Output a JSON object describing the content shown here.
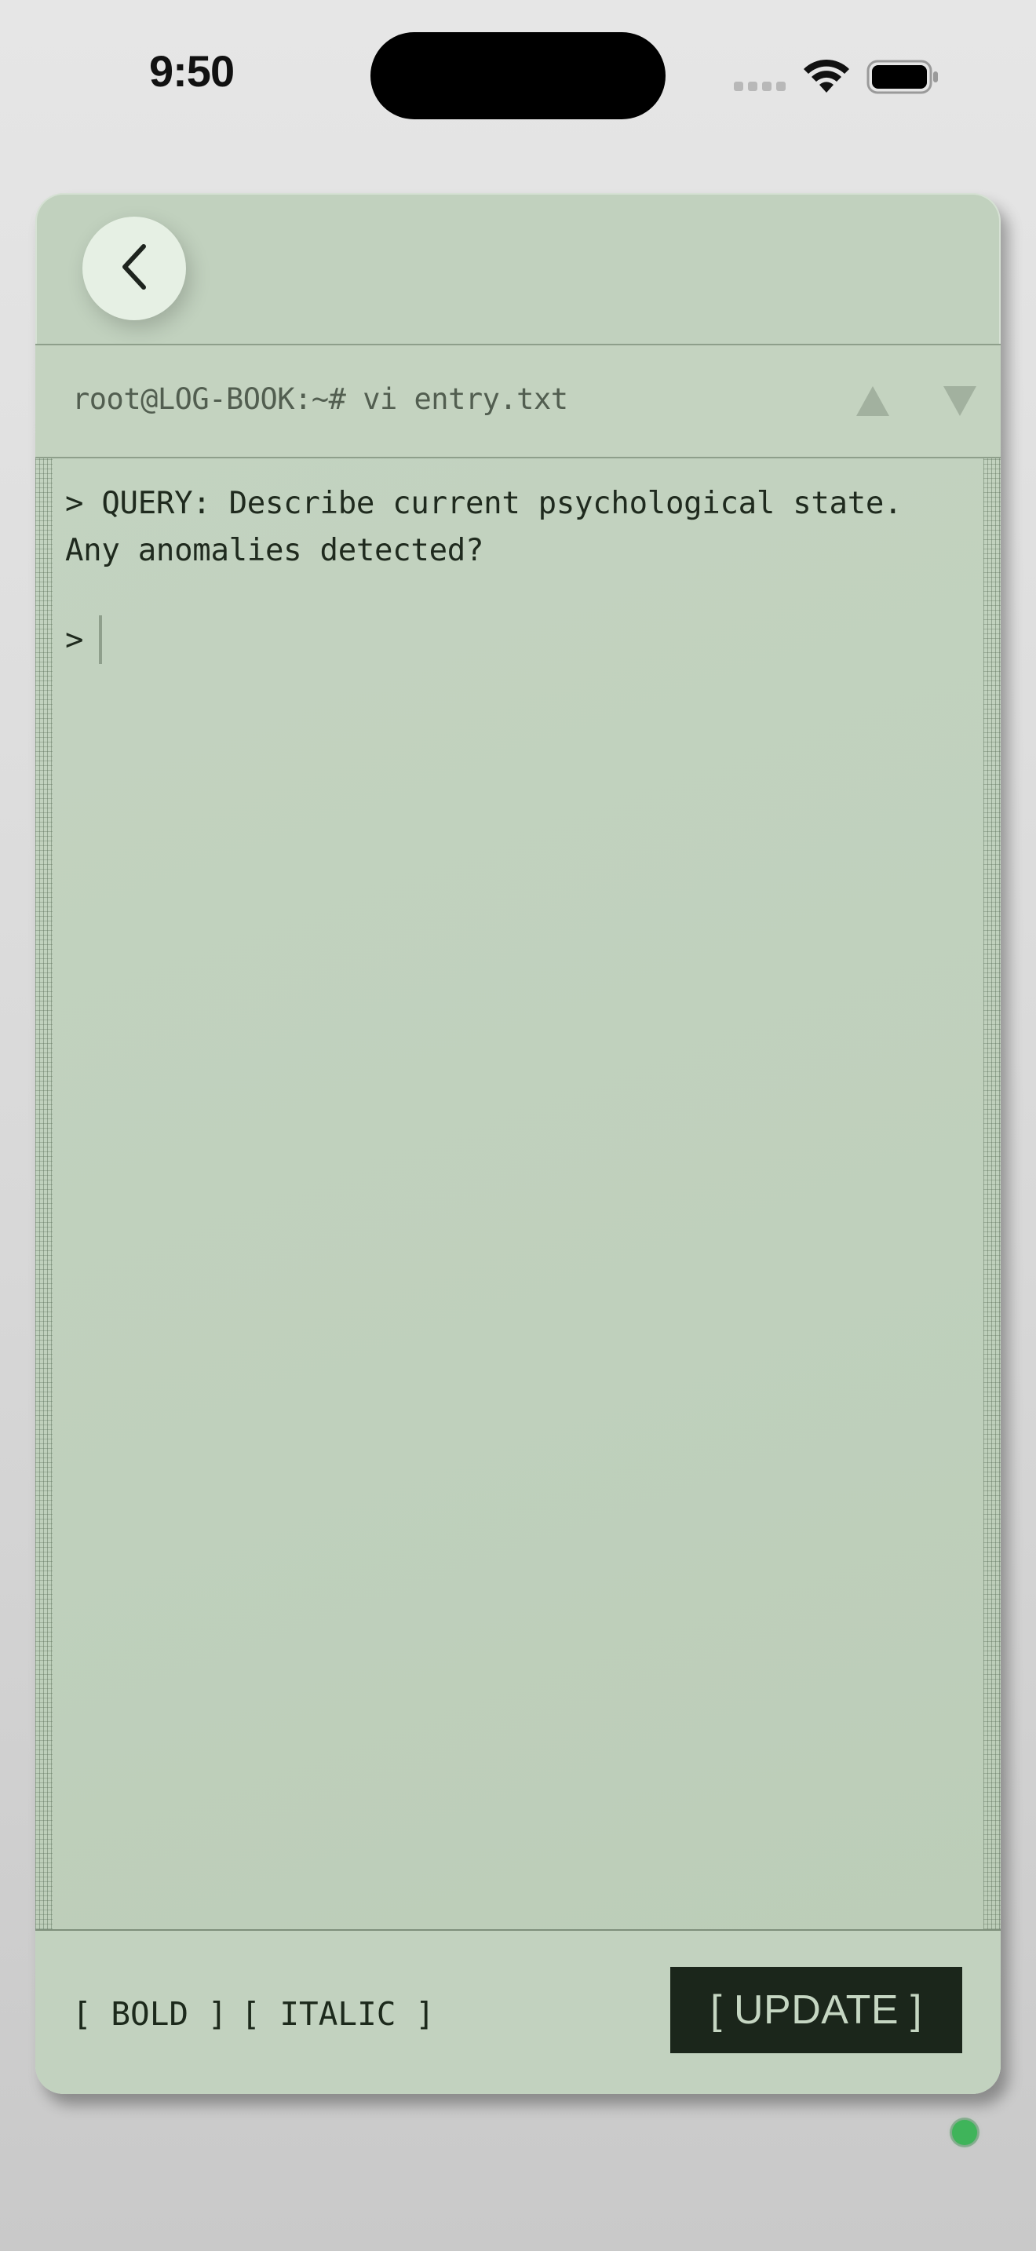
{
  "status_bar": {
    "time": "9:50",
    "icons": [
      "signal-icon",
      "wifi-icon",
      "battery-icon"
    ]
  },
  "header": {
    "back_icon": "chevron-left-icon",
    "command": "root@LOG-BOOK:~# vi entry.txt",
    "nav_icons": [
      "triangle-up-icon",
      "triangle-down-icon"
    ]
  },
  "editor": {
    "query": "> QUERY: Describe current psychological state.\nAny anomalies detected?",
    "input_prompt": ">",
    "input_value": ""
  },
  "footer": {
    "bold_label": "[ BOLD ]",
    "italic_label": "[ ITALIC ]",
    "update_label": "[ UPDATE ]"
  },
  "colors": {
    "card_bg": "#c1d1be",
    "text_dark": "#1f2a1e",
    "button_dark": "#1b261b",
    "status_led": "#3fb45a"
  }
}
